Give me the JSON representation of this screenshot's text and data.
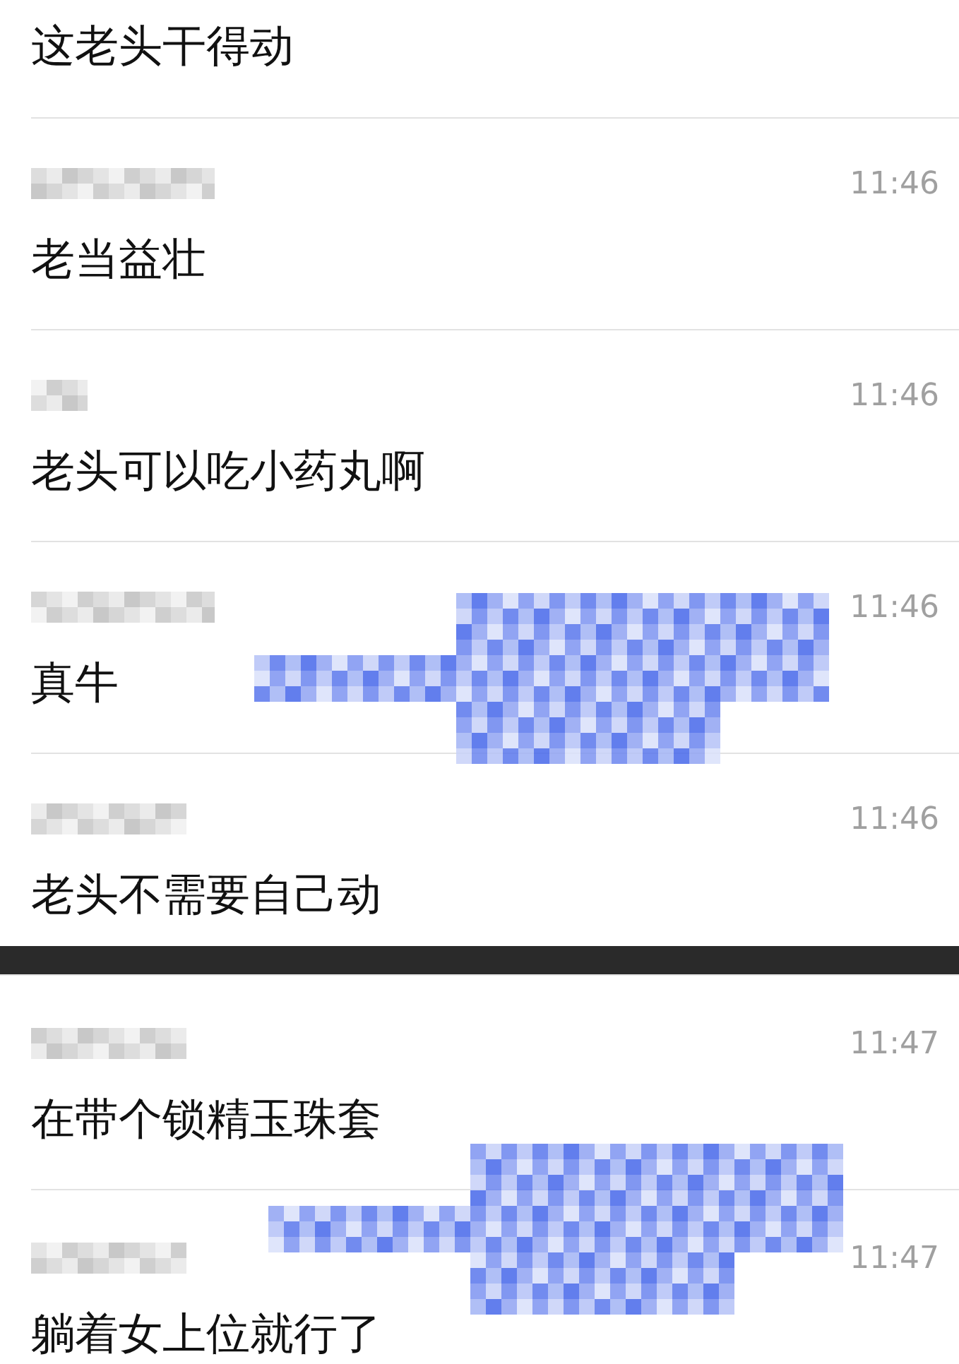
{
  "sections": [
    {
      "messages": [
        {
          "kind": "cut",
          "text": "这老头干得动"
        },
        {
          "kind": "full",
          "time": "11:46",
          "text": "老当益壮"
        },
        {
          "kind": "full",
          "time": "11:46",
          "text": "老头可以吃小药丸啊"
        },
        {
          "kind": "full",
          "time": "11:46",
          "text": "真牛"
        },
        {
          "kind": "full",
          "time": "11:46",
          "text": "老头不需要自己动"
        }
      ]
    },
    {
      "messages": [
        {
          "kind": "full",
          "time": "11:47",
          "text": "在带个锁精玉珠套"
        },
        {
          "kind": "full",
          "time": "11:47",
          "text": "躺着女上位就行了"
        }
      ]
    }
  ]
}
